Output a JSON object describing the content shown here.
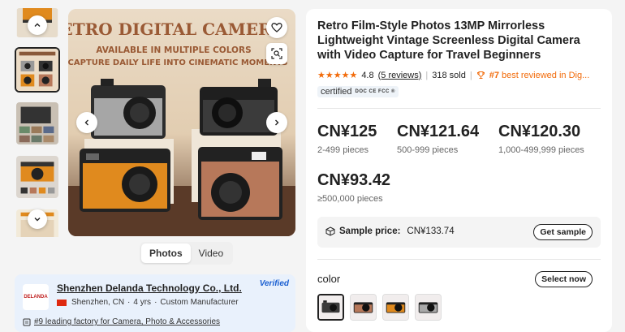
{
  "gallery": {
    "scroll_up_icon": "chevron-up-icon",
    "scroll_down_icon": "chevron-down-icon",
    "thumbnail_count": 5,
    "active_thumbnail": 1,
    "main_image_headline": "RETRO DIGITAL CAMERA",
    "main_image_subline1": "AVAILABLE IN MULTIPLE COLORS",
    "main_image_subline2": "CAPTURE DAILY LIFE INTO CINEMATIC MOMENTS",
    "favorite_icon": "heart-icon",
    "image_search_icon": "image-search-icon",
    "prev_icon": "chevron-left-icon",
    "next_icon": "chevron-right-icon"
  },
  "media_tabs": [
    {
      "label": "Photos",
      "active": true
    },
    {
      "label": "Video",
      "active": false
    }
  ],
  "supplier": {
    "logo_text": "DELANDA",
    "name": "Shenzhen Delanda Technology Co., Ltd.",
    "location": "Shenzhen, CN",
    "years": "4 yrs",
    "type": "Custom Manufacturer",
    "verified_label": "Verified",
    "rank_text": "#9 leading factory for Camera, Photo & Accessories"
  },
  "product": {
    "title": "Retro Film-Style Photos 13MP Mirrorless Lightweight Vintage Screenless Digital Camera with Video Capture for Travel Beginners",
    "rating": "4.8",
    "stars": "★★★★★",
    "reviews": "(5 reviews)",
    "sold": "318 sold",
    "rank_prefix": "#7",
    "rank_text": "best reviewed in Dig...",
    "certified_label": "certified",
    "cert_marks": "DOC CE FCC ®"
  },
  "prices": [
    {
      "price": "CN¥125",
      "qty": "2-499 pieces"
    },
    {
      "price": "CN¥121.64",
      "qty": "500-999 pieces"
    },
    {
      "price": "CN¥120.30",
      "qty": "1,000-499,999 pieces"
    },
    {
      "price": "CN¥93.42",
      "qty": "≥500,000 pieces"
    }
  ],
  "sample": {
    "label": "Sample price:",
    "value": "CN¥133.74",
    "button": "Get sample",
    "icon": "box-icon"
  },
  "color": {
    "label": "color",
    "button": "Select now",
    "swatches": [
      {
        "name": "black",
        "color": "#3a3a3a",
        "selected": true
      },
      {
        "name": "brown",
        "color": "#b7785a",
        "selected": false
      },
      {
        "name": "orange",
        "color": "#e08a1e",
        "selected": false
      },
      {
        "name": "silver",
        "color": "#a9a9a9",
        "selected": false
      }
    ]
  }
}
